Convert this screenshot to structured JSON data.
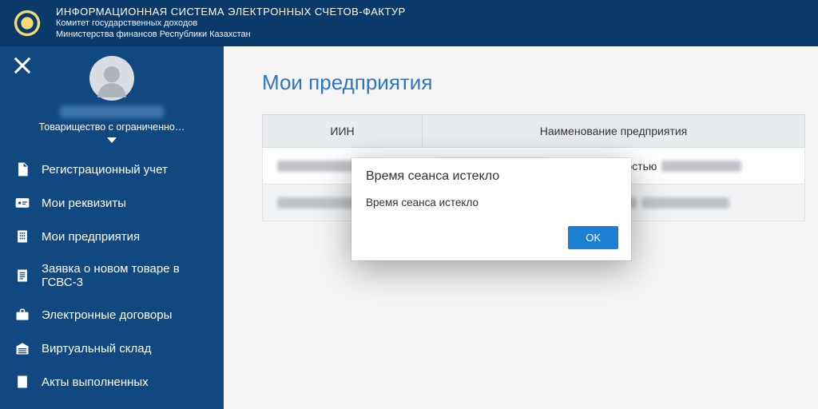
{
  "header": {
    "title": "ИНФОРМАЦИОННАЯ СИСТЕМА ЭЛЕКТРОННЫХ СЧЕТОВ-ФАКТУР",
    "subtitle1": "Комитет государственных доходов",
    "subtitle2": "Министерства финансов Республики Казахстан"
  },
  "sidebar": {
    "org_type": "Товарищество с ограниченно…",
    "items": [
      {
        "label": "Регистрационный учет"
      },
      {
        "label": "Мои реквизиты"
      },
      {
        "label": "Мои предприятия"
      },
      {
        "label": "Заявка о новом товаре в ГСВС-3"
      },
      {
        "label": "Электронные договоры"
      },
      {
        "label": "Виртуальный склад"
      },
      {
        "label": "Акты выполненных"
      }
    ]
  },
  "main": {
    "page_title": "Мои предприятия",
    "columns": {
      "iin": "ИИН",
      "name": "Наименование предприятия"
    },
    "rows": [
      {
        "name_fragment": "й ответственностью"
      },
      {
        "name_fragment": ""
      }
    ]
  },
  "modal": {
    "title": "Время сеанса истекло",
    "message": "Время сеанса истекло",
    "ok": "OK"
  }
}
